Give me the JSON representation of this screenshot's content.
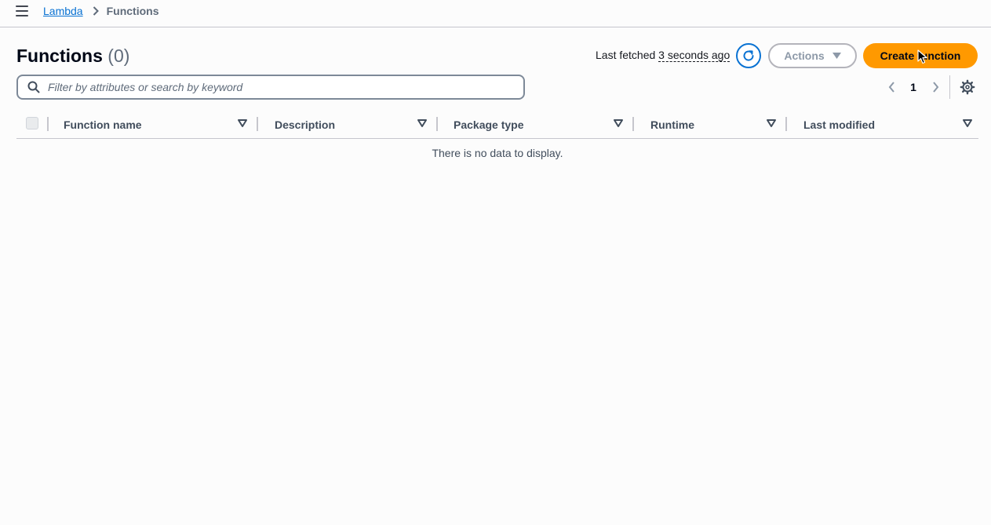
{
  "breadcrumb": {
    "root": "Lambda",
    "current": "Functions"
  },
  "header": {
    "title": "Functions",
    "count": "(0)",
    "last_fetched_label": "Last fetched",
    "last_fetched_time": "3 seconds ago"
  },
  "toolbar": {
    "actions_label": "Actions",
    "create_label": "Create function"
  },
  "filter": {
    "placeholder": "Filter by attributes or search by keyword"
  },
  "pagination": {
    "page": "1"
  },
  "table": {
    "columns": [
      "Function name",
      "Description",
      "Package type",
      "Runtime",
      "Last modified"
    ],
    "empty_message": "There is no data to display."
  },
  "colors": {
    "primary": "#ff9900",
    "link": "#0972d3"
  }
}
